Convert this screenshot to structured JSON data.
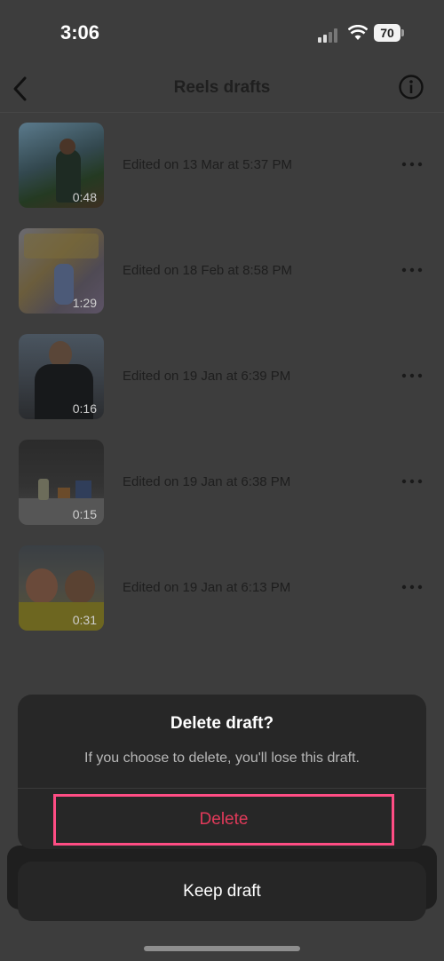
{
  "status_bar": {
    "time": "3:06",
    "battery": "70",
    "signal_icon": "signal-bars-icon",
    "wifi_icon": "wifi-icon"
  },
  "nav": {
    "title": "Reels drafts",
    "back_icon": "chevron-left-icon",
    "info_icon": "info-circle-icon"
  },
  "drafts": [
    {
      "duration": "0:48",
      "date": "Edited on 13 Mar at 5:37 PM"
    },
    {
      "duration": "1:29",
      "date": "Edited on 18 Feb at 8:58 PM"
    },
    {
      "duration": "0:16",
      "date": "Edited on 19 Jan at 6:39 PM"
    },
    {
      "duration": "0:15",
      "date": "Edited on 19 Jan at 6:38 PM"
    },
    {
      "duration": "0:31",
      "date": "Edited on 19 Jan at 6:13 PM"
    }
  ],
  "dialog": {
    "title": "Delete draft?",
    "message": "If you choose to delete, you'll lose this draft.",
    "delete_label": "Delete",
    "keep_label": "Keep draft"
  },
  "colors": {
    "delete_text": "#e23a5a",
    "highlight_border": "#ff4d84",
    "overlay": "#3d3d3d"
  }
}
